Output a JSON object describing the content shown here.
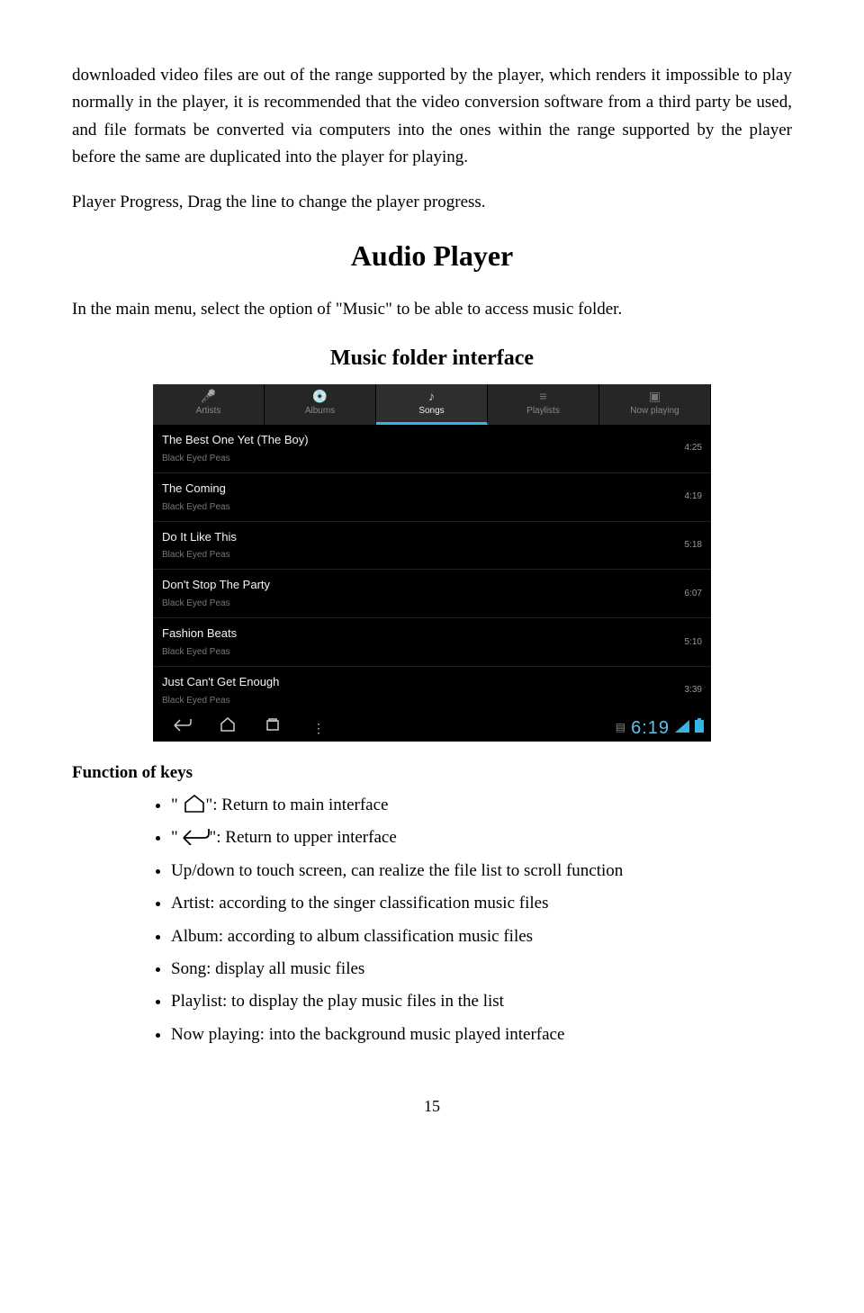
{
  "para1": "downloaded video files are out of the range supported by the player, which renders it impossible to play normally in the player, it is recommended that the video conversion software from a third party be used, and file formats be converted via computers into the ones within the range supported by the player before the same are duplicated into the player for playing.",
  "para2": "Player Progress, Drag the line to change the player progress.",
  "heading_audio": "Audio Player",
  "para3": "In the main menu, select the option of \"Music\" to be able to access music folder.",
  "heading_music_folder": "Music folder interface",
  "screenshot": {
    "tabs": [
      {
        "label": "Artists",
        "icon": "🎤"
      },
      {
        "label": "Albums",
        "icon": "💿"
      },
      {
        "label": "Songs",
        "icon": "♪",
        "active": true
      },
      {
        "label": "Playlists",
        "icon": "≡"
      },
      {
        "label": "Now playing",
        "icon": "▣"
      }
    ],
    "songs": [
      {
        "title": "The Best One Yet (The Boy)",
        "artist": "Black Eyed Peas",
        "dur": "4:25"
      },
      {
        "title": "The Coming",
        "artist": "Black Eyed Peas",
        "dur": "4:19"
      },
      {
        "title": "Do It Like This",
        "artist": "Black Eyed Peas",
        "dur": "5:18"
      },
      {
        "title": "Don't Stop The Party",
        "artist": "Black Eyed Peas",
        "dur": "6:07"
      },
      {
        "title": "Fashion Beats",
        "artist": "Black Eyed Peas",
        "dur": "5:10"
      },
      {
        "title": "Just Can't Get Enough",
        "artist": "Black Eyed Peas",
        "dur": "3:39"
      }
    ],
    "clock": "6:19"
  },
  "func_heading": "Function of keys",
  "func_items": {
    "i0a": "\" ",
    "i0b": "\": Return to main interface",
    "i1a": "\" ",
    "i1b": "\": Return to upper interface",
    "i2": "Up/down to touch screen, can realize the file list to scroll function",
    "i3": "Artist: according to the singer classification music files",
    "i4": "Album: according to album classification music files",
    "i5": "Song: display all music files",
    "i6": "Playlist: to display the play music files in the list",
    "i7": "Now playing: into the background music played interface"
  },
  "page_number": "15"
}
